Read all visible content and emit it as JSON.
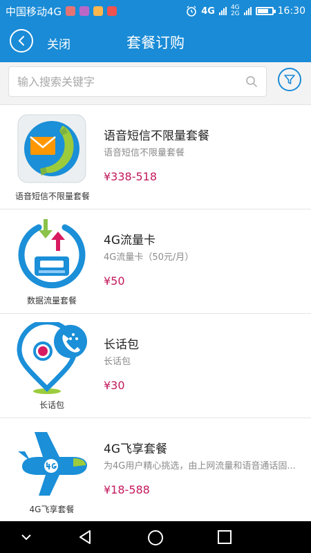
{
  "status_bar": {
    "carrier": "中国移动4G",
    "network_primary": "4G",
    "network_secondary": "4G",
    "network_tertiary": "2G",
    "time": "16:30"
  },
  "header": {
    "close_label": "关闭",
    "title": "套餐订购"
  },
  "search": {
    "placeholder": "输入搜索关键字"
  },
  "products": [
    {
      "thumb_caption": "语音短信不限量套餐",
      "title": "语音短信不限量套餐",
      "description": "语音短信不限量套餐",
      "price": "¥338-518"
    },
    {
      "thumb_caption": "数据流量套餐",
      "title": "4G流量卡",
      "description": "4G流量卡（50元/月）",
      "price": "¥50"
    },
    {
      "thumb_caption": "长话包",
      "title": "长话包",
      "description": "长话包",
      "price": "¥30"
    },
    {
      "thumb_caption": "4G飞享套餐",
      "title": "4G飞享套餐",
      "description": "为4G用户精心挑选，由上网流量和语音通话固...",
      "price": "¥18-588"
    }
  ],
  "colors": {
    "brand_blue": "#1a8bd6",
    "price": "#c2185b"
  }
}
